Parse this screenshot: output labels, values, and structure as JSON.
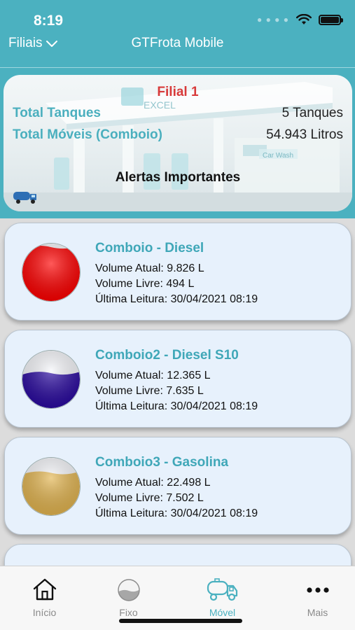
{
  "status_bar": {
    "time": "8:19"
  },
  "header": {
    "filiais_label": "Filiais",
    "title": "GTFrota Mobile"
  },
  "summary": {
    "filial_name": "Filial 1",
    "total_tanques_label": "Total Tanques",
    "total_tanques_value": "5 Tanques",
    "total_moveis_label": "Total Móveis (Comboio)",
    "total_moveis_value": "54.943 Litros",
    "alerts_label": "Alertas Importantes",
    "station_sign": "EXCEL",
    "car_wash_sign": "Car Wash"
  },
  "tanks": [
    {
      "name": "Comboio - Diesel",
      "volume_atual": "Volume Atual: 9.826 L",
      "volume_livre": "Volume Livre: 494 L",
      "ultima_leitura": "Última Leitura: 30/04/2021 08:19",
      "fill_fraction": 0.95,
      "color": "#ff0000"
    },
    {
      "name": "Comboio2 - Diesel S10",
      "volume_atual": "Volume Atual: 12.365 L",
      "volume_livre": "Volume Livre: 7.635 L",
      "ultima_leitura": "Última Leitura: 30/04/2021 08:19",
      "fill_fraction": 0.62,
      "color": "#2a0aa0"
    },
    {
      "name": "Comboio3 - Gasolina",
      "volume_atual": "Volume Atual: 22.498 L",
      "volume_livre": "Volume Livre: 7.502 L",
      "ultima_leitura": "Última Leitura: 30/04/2021 08:19",
      "fill_fraction": 0.75,
      "color": "#e3b550"
    }
  ],
  "tabs": [
    {
      "label": "Início",
      "icon": "home-icon",
      "active": false
    },
    {
      "label": "Fixo",
      "icon": "fixed-tank-icon",
      "active": false
    },
    {
      "label": "Móvel",
      "icon": "tanker-truck-icon",
      "active": true
    },
    {
      "label": "Mais",
      "icon": "more-icon",
      "active": false
    }
  ]
}
